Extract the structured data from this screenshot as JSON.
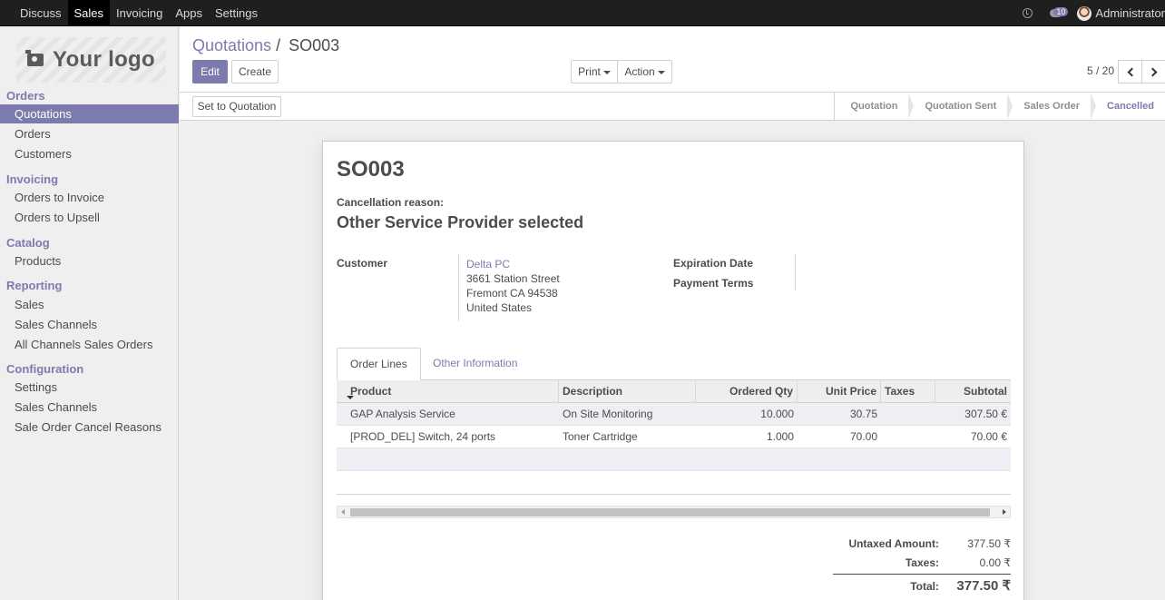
{
  "topbar": {
    "menu": [
      "Discuss",
      "Sales",
      "Invoicing",
      "Apps",
      "Settings"
    ],
    "active": "Sales",
    "messages_badge": "10",
    "user": "Administrator"
  },
  "sidebar": {
    "logo_text": "Your logo",
    "sections": {
      "orders": "Orders",
      "invoicing": "Invoicing",
      "catalog": "Catalog",
      "reporting": "Reporting",
      "configuration": "Configuration"
    },
    "items": {
      "quotations": "Quotations",
      "orders": "Orders",
      "customers": "Customers",
      "orders_to_invoice": "Orders to Invoice",
      "orders_to_upsell": "Orders to Upsell",
      "products": "Products",
      "sales": "Sales",
      "sales_channels": "Sales Channels",
      "all_channels_sales_orders": "All Channels Sales Orders",
      "settings": "Settings",
      "sales_channels_config": "Sales Channels",
      "cancel_reasons": "Sale Order Cancel Reasons"
    }
  },
  "control_panel": {
    "breadcrumb_parent": "Quotations",
    "breadcrumb_sep": "/",
    "breadcrumb_current": "SO003",
    "edit_label": "Edit",
    "create_label": "Create",
    "print_label": "Print",
    "action_label": "Action",
    "pager": "5 / 20"
  },
  "statusbar": {
    "set_to_quotation_label": "Set to Quotation",
    "stages": [
      "Quotation",
      "Quotation Sent",
      "Sales Order",
      "Cancelled"
    ],
    "current_stage": "Cancelled"
  },
  "form": {
    "title": "SO003",
    "cancellation_reason_label": "Cancellation reason:",
    "cancellation_reason": "Other Service Provider selected",
    "customer_label": "Customer",
    "customer": {
      "name": "Delta PC",
      "street": "3661 Station Street",
      "city": "Fremont CA 94538",
      "country": "United States"
    },
    "expiration_date_label": "Expiration Date",
    "payment_terms_label": "Payment Terms",
    "tabs": {
      "order_lines": "Order Lines",
      "other_information": "Other Information"
    },
    "table": {
      "headers": {
        "product": "Product",
        "description": "Description",
        "ordered_qty": "Ordered Qty",
        "unit_price": "Unit Price",
        "taxes": "Taxes",
        "subtotal": "Subtotal"
      },
      "rows": [
        {
          "product": "GAP Analysis Service",
          "description": "On Site Monitoring",
          "qty": "10.000",
          "price": "30.75",
          "taxes": "",
          "subtotal": "307.50 €"
        },
        {
          "product": "[PROD_DEL] Switch, 24 ports",
          "description": "Toner Cartridge",
          "qty": "1.000",
          "price": "70.00",
          "taxes": "",
          "subtotal": "70.00 €"
        }
      ]
    },
    "totals": {
      "untaxed_label": "Untaxed Amount:",
      "untaxed_value": "377.50 ₹",
      "taxes_label": "Taxes:",
      "taxes_value": "0.00 ₹",
      "total_label": "Total:",
      "total_value": "377.50 ₹"
    }
  }
}
